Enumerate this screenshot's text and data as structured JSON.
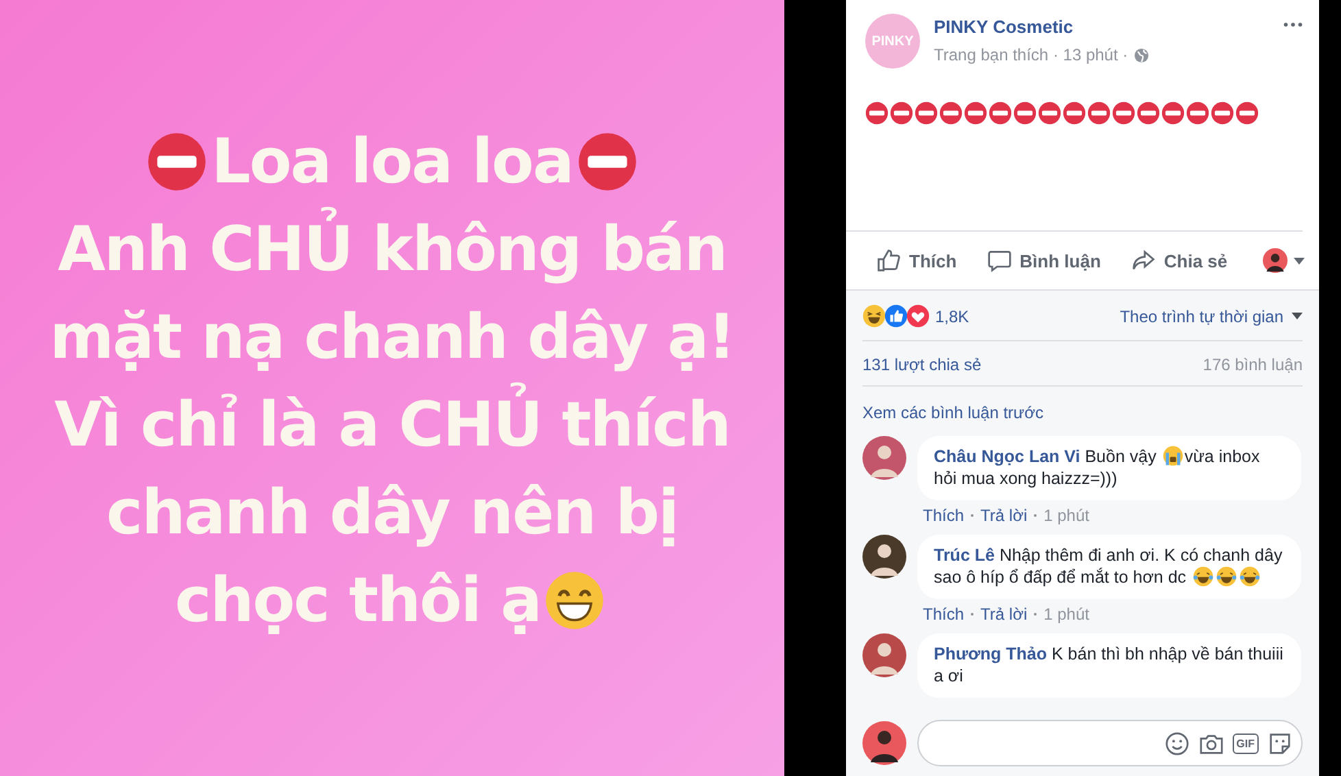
{
  "image": {
    "lines": [
      [
        {
          "kind": "no-entry"
        },
        {
          "kind": "text",
          "text": "Loa loa loa"
        },
        {
          "kind": "no-entry"
        }
      ],
      [
        {
          "kind": "text",
          "text": "Anh CHỦ không bán"
        }
      ],
      [
        {
          "kind": "text",
          "text": "mặt nạ chanh dây ạ!"
        }
      ],
      [
        {
          "kind": "text",
          "text": "Vì chỉ là a CHỦ thích"
        }
      ],
      [
        {
          "kind": "text",
          "text": "chanh dây nên bị"
        }
      ],
      [
        {
          "kind": "text",
          "text": "chọc thôi ạ "
        },
        {
          "kind": "grin"
        }
      ]
    ]
  },
  "post": {
    "logo_text": "PINKY",
    "page_name": "PINKY Cosmetic",
    "meta": "Trang bạn thích · 13 phút ·",
    "body": [
      {
        "kind": "no-entry"
      },
      {
        "kind": "no-entry"
      },
      {
        "kind": "no-entry"
      },
      {
        "kind": "no-entry"
      },
      {
        "kind": "no-entry"
      },
      {
        "kind": "no-entry"
      },
      {
        "kind": "no-entry"
      },
      {
        "kind": "no-entry"
      },
      {
        "kind": "no-entry"
      },
      {
        "kind": "no-entry"
      },
      {
        "kind": "no-entry"
      },
      {
        "kind": "no-entry"
      },
      {
        "kind": "no-entry"
      },
      {
        "kind": "no-entry"
      },
      {
        "kind": "no-entry"
      },
      {
        "kind": "no-entry"
      }
    ],
    "actions": [
      {
        "kind": "like",
        "label": "Thích"
      },
      {
        "kind": "comment",
        "label": "Bình luận"
      },
      {
        "kind": "share",
        "label": "Chia sẻ"
      }
    ]
  },
  "reactions": {
    "icons": [
      {
        "kind": "haha"
      },
      {
        "kind": "like"
      },
      {
        "kind": "love"
      }
    ],
    "count": "1,8K",
    "sort": "Theo trình tự thời gian"
  },
  "stats": {
    "shares": "131 lượt chia sẻ",
    "comments": "176 bình luận"
  },
  "view_previous": "Xem các bình luận trước",
  "comments": [
    {
      "author": "Châu Ngọc Lan Vi",
      "body": [
        {
          "kind": "text",
          "text": "Buồn vậy "
        },
        {
          "kind": "cry"
        },
        {
          "kind": "text",
          "text": "vừa inbox hỏi mua xong haizzz=)))"
        }
      ],
      "like": "Thích",
      "reply": "Trả lời",
      "time": "1 phút"
    },
    {
      "author": "Trúc Lê",
      "body": [
        {
          "kind": "text",
          "text": "Nhập thêm đi anh ơi. K có chanh dây sao ô híp ổ đấp để mắt to hơn dc "
        },
        {
          "kind": "laugh"
        },
        {
          "kind": "laugh"
        },
        {
          "kind": "laugh"
        }
      ],
      "like": "Thích",
      "reply": "Trả lời",
      "time": "1 phút"
    },
    {
      "author": "Phương Thảo",
      "body": [
        {
          "kind": "text",
          "text": "K bán thì bh nhập về bán thuiii a ơi"
        }
      ]
    }
  ],
  "composer": {
    "tools": [
      {
        "kind": "smiley"
      },
      {
        "kind": "camera"
      },
      {
        "kind": "gif"
      },
      {
        "kind": "sticker"
      }
    ],
    "gif_label": "GIF"
  }
}
